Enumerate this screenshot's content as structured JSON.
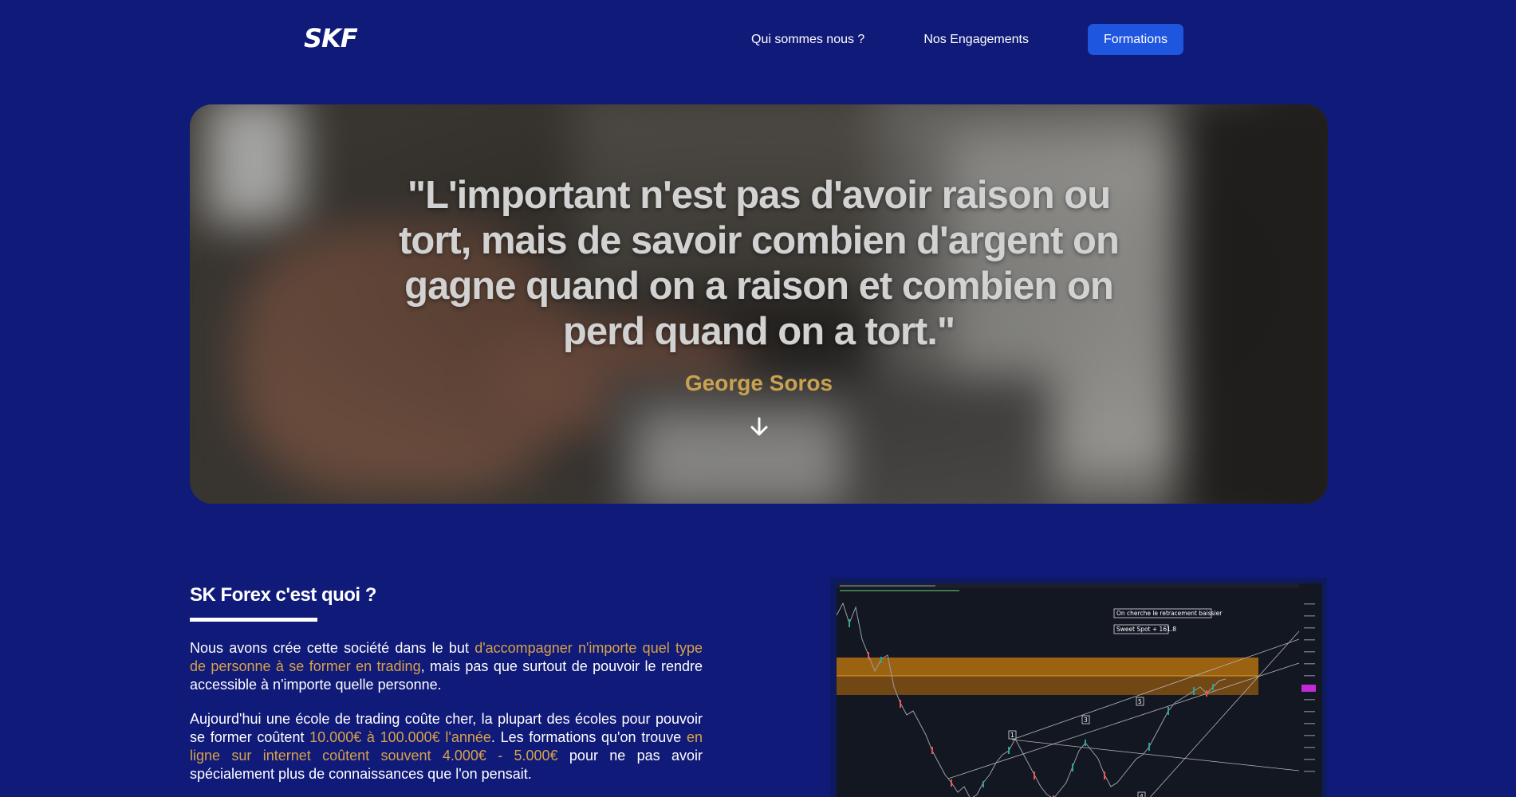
{
  "header": {
    "logo": "SKF",
    "nav": {
      "about": "Qui sommes nous ?",
      "commitments": "Nos Engagements",
      "trainings": "Formations"
    }
  },
  "hero": {
    "quote": "\"L'important n'est pas d'avoir raison ou tort, mais de savoir combien d'argent on gagne quand on a raison et combien on perd quand on a tort.\"",
    "author": "George Soros",
    "icon": "arrow-down-icon"
  },
  "about": {
    "title": "SK Forex c'est quoi ?",
    "p1": {
      "a": "Nous avons crée cette société dans le but ",
      "b": "d'accompagner n'importe quel type de personne à se former en trading",
      "c": ", mais pas que surtout de pouvoir le rendre accessible à n'importe quelle personne."
    },
    "p2": {
      "a": "Aujourd'hui une école de trading coûte cher, la plupart des écoles pour pouvoir se former coûtent ",
      "b": "10.000€ à 100.000€ l'année",
      "c": ". Les formations qu'on trouve ",
      "d": "en ligne sur internet coûtent souvent 4.000€ - 5.000€",
      "e": " pour ne pas avoir spécialement plus de connaissances que l'on pensait."
    }
  },
  "chart_image": {
    "label_retracement": "On cherche le retracement baissier",
    "label_sweet_spot": "Sweet Spot + 161.8",
    "wave_labels": [
      "1",
      "3",
      "5",
      "4"
    ]
  },
  "colors": {
    "background": "#101a78",
    "accent_button": "#1f56e0",
    "highlight": "#d6a24a",
    "author": "#c9a24f"
  }
}
